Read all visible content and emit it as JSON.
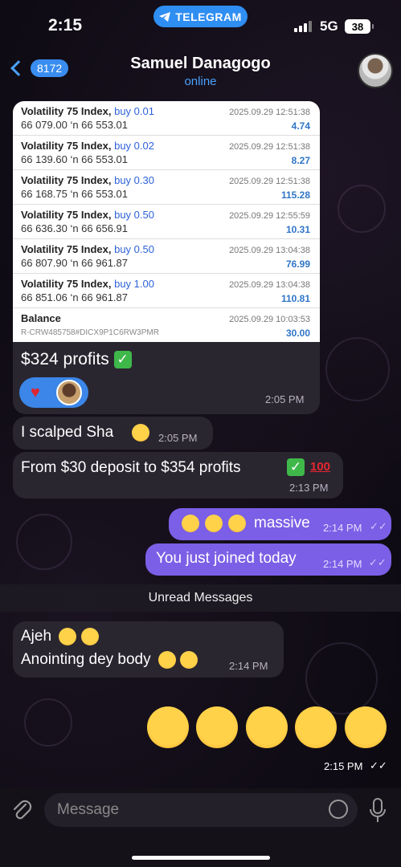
{
  "status": {
    "time": "2:15",
    "app_pill": "TELEGRAM",
    "network": "5G",
    "battery": "38"
  },
  "header": {
    "back_count": "8172",
    "title": "Samuel Danagogo",
    "subtitle": "online"
  },
  "trades": [
    {
      "label": "Volatility 75 Index,",
      "action": "buy 0.01",
      "prices": "66 079.00 ‘n 66 553.01",
      "date": "2025.09.29 12:51:38",
      "profit": "4.74"
    },
    {
      "label": "Volatility 75 Index,",
      "action": "buy 0.02",
      "prices": "66 139.60 ‘n 66 553.01",
      "date": "2025.09.29 12:51:38",
      "profit": "8.27"
    },
    {
      "label": "Volatility 75 Index,",
      "action": "buy 0.30",
      "prices": "66 168.75 ‘n 66 553.01",
      "date": "2025.09.29 12:51:38",
      "profit": "115.28"
    },
    {
      "label": "Volatility 75 Index,",
      "action": "buy 0.50",
      "prices": "66 636.30 ‘n 66 656.91",
      "date": "2025.09.29 12:55:59",
      "profit": "10.31"
    },
    {
      "label": "Volatility 75 Index,",
      "action": "buy 0.50",
      "prices": "66 807.90 ‘n 66 961.87",
      "date": "2025.09.29 13:04:38",
      "profit": "76.99"
    },
    {
      "label": "Volatility 75 Index,",
      "action": "buy 1.00",
      "prices": "66 851.06 ‘n 66 961.87",
      "date": "2025.09.29 13:04:38",
      "profit": "110.81"
    }
  ],
  "balance": {
    "label": "Balance",
    "account": "R-CRW485758#DICX9P1C6RW3PMR",
    "date": "2025.09.29 10:03:53",
    "amount": "30.00"
  },
  "messages": {
    "m1_text": "$324 profits",
    "m1_time": "2:05 PM",
    "m2_text": "I scalped Sha",
    "m2_time": "2:05 PM",
    "m3_text": "From $30 deposit to $354 profits",
    "m3_time": "2:13 PM",
    "m4_text": "massive",
    "m4_time": "2:14 PM",
    "m5_text": "You just joined today",
    "m5_time": "2:14 PM",
    "unread": "Unread Messages",
    "m6_line1": "Ajeh",
    "m6_line2": "Anointing dey body",
    "m6_time": "2:14 PM",
    "m7_time": "2:15 PM"
  },
  "input": {
    "placeholder": "Message"
  },
  "icons": [
    "telegram-icon",
    "back-chevron-icon",
    "attach-icon",
    "sticker-icon",
    "mic-icon",
    "heart-icon",
    "check-icon",
    "laughing-emoji",
    "rofl-emoji",
    "hundred-emoji"
  ]
}
